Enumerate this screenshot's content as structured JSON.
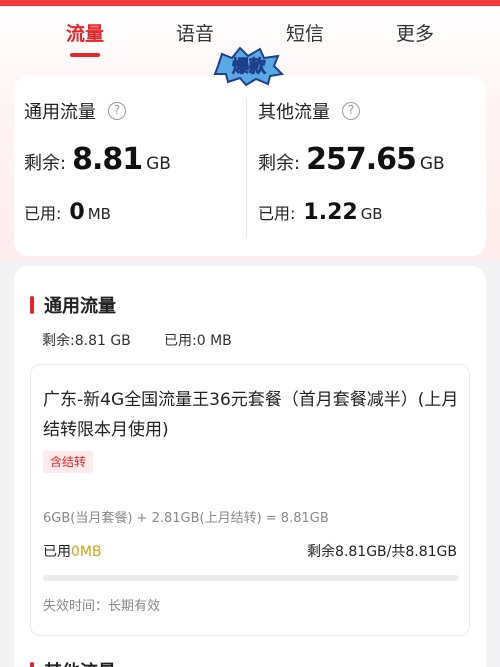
{
  "tabs": [
    {
      "label": "流量",
      "active": true
    },
    {
      "label": "语音",
      "active": false
    },
    {
      "label": "短信",
      "active": false
    },
    {
      "label": "更多",
      "active": false
    }
  ],
  "badge": {
    "text": "爆款"
  },
  "summary": {
    "general": {
      "title": "通用流量",
      "remain_label": "剩余:",
      "remain_value": "8.81",
      "remain_unit": "GB",
      "used_label": "已用:",
      "used_value": "0",
      "used_unit": "MB"
    },
    "other": {
      "title": "其他流量",
      "remain_label": "剩余:",
      "remain_value": "257.65",
      "remain_unit": "GB",
      "used_label": "已用:",
      "used_value": "1.22",
      "used_unit": "GB"
    }
  },
  "detail": {
    "section_title": "通用流量",
    "remain_text": "剩余:8.81 GB",
    "used_text": "已用:0 MB",
    "plan": {
      "name": "广东-新4G全国流量王36元套餐（首月套餐减半）(上月结转限本月使用)",
      "tag": "含结转",
      "formula": "6GB(当月套餐) + 2.81GB(上月结转) = 8.81GB",
      "used_prefix": "已用",
      "used_value": "0MB",
      "remain_total": "剩余8.81GB/共8.81GB",
      "usage_fraction": 0,
      "expire": "失效时间：长期有效"
    },
    "next_section_title": "其他流量"
  },
  "colors": {
    "accent": "#e8262a",
    "gold": "#d9a318"
  },
  "icons": {
    "help": "question-circle-icon"
  }
}
